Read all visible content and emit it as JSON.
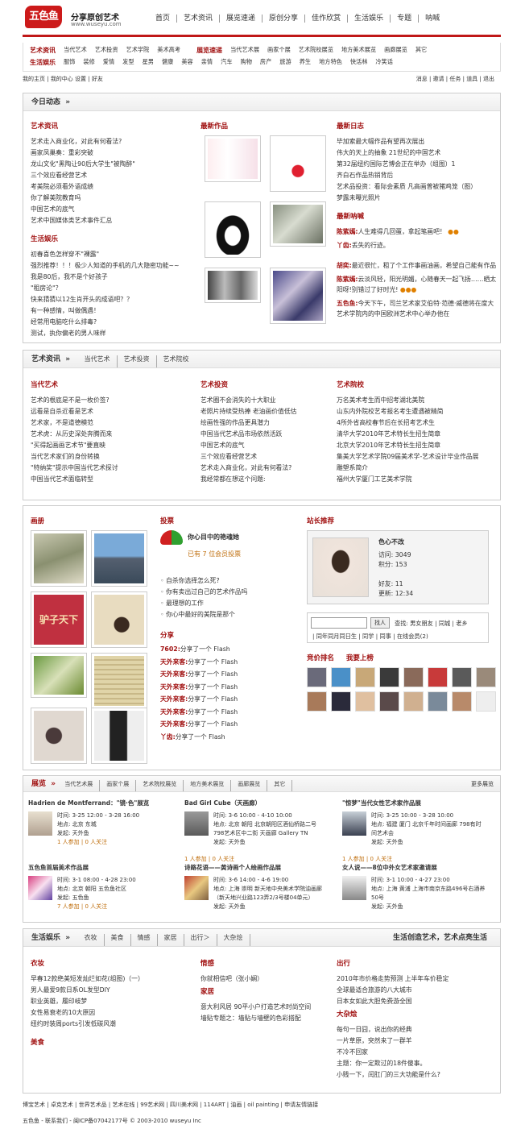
{
  "header": {
    "logo": "五色鱼",
    "slogan": "分享原创艺术",
    "site": "www.wuseyu.com",
    "nav": [
      "首页",
      "艺术资讯",
      "展览速递",
      "原创分享",
      "佳作欣赏",
      "生活娱乐",
      "专题",
      "呐喊"
    ]
  },
  "subnav": {
    "row1": [
      {
        "label": "艺术资讯",
        "items": [
          "当代艺术",
          "艺术投资",
          "艺术学院",
          "美术高考"
        ]
      },
      {
        "label": "展览速递",
        "items": [
          "当代艺术展",
          "画家个展",
          "艺术院校展览",
          "地方美术展览",
          "画廊展览",
          "其它"
        ]
      }
    ],
    "row2": {
      "label": "生活娱乐",
      "items": [
        "服饰",
        "装修",
        "爱情",
        "发型",
        "星男",
        "健康",
        "美容",
        "亲情",
        "汽车",
        "购物",
        "房产",
        "旅游",
        "养生",
        "地方特色",
        "快活林",
        "冷笑话"
      ]
    }
  },
  "userbar": {
    "left": [
      "我的主页",
      "我的中心",
      "设置",
      "好友"
    ],
    "right": [
      "消息",
      "邀请",
      "任务",
      "道具",
      "退出"
    ]
  },
  "today": {
    "title": "今日动态",
    "arrow": "»",
    "art_news": {
      "title": "艺术资讯",
      "items": [
        "艺术走入商业化，对此有何看法?",
        "画家凤巢奏：重彩突破",
        "龙山文化\"黑陶让90后大学生\"被陶醉\"",
        "三个效应看经营艺术",
        "考美院必须看外语成绩",
        "你了解美院教育吗",
        "中国艺术的底气",
        "艺术中国媒体类艺术事件汇总"
      ]
    },
    "life": {
      "title": "生活娱乐",
      "items": [
        "初春喜色怎样穿不\"裸露\"",
        "强烈推荐！！！极少人知道的手机的几大隐密功能~~",
        "我是80后，我不是个好孩子",
        "\"租房论\"？",
        "快来猜猜以12生肖开头的成语吧？？",
        "有一种感情，叫做偶遇！",
        "经常用电脑吃什么排毒?",
        "测试，执你偏老的男人味样"
      ]
    },
    "works": {
      "title": "最新作品"
    },
    "logs": {
      "title": "最新日志",
      "items": [
        "毕加索最大幅作品有望再次展出",
        "伟大的天上的抽象 21世纪的中国艺术",
        "第32届纽约国际艺博会正在举办（组图）1",
        "齐白石作品热销背后",
        "艺术品投资：看际会素质 凡高画曾被猪鸡笼（图）",
        "梦露未曝光照片"
      ]
    },
    "shouts": {
      "title": "最新呐喊",
      "items": [
        {
          "user": "陈紫嫣:",
          "text": "人生难得几回蛋，拿起笔画吧！"
        },
        {
          "user": "丫齿:",
          "text": "丢失的行迹。"
        },
        {
          "user": "胡奕:",
          "text": "最近很忙，租了个工作事画油画，希望自己能有作品"
        },
        {
          "user": "陈紫嫣:",
          "text": "云淡风轻，阳光明媚，心随春天一起飞扬……晒太阳呀!别错过了好时光!"
        },
        {
          "user": "五色鱼:",
          "text": "今天下午，司兰艺术家艾伯特·范德·威德将在度大艺术学院内的中国欧洲艺术中心举办他在"
        }
      ]
    }
  },
  "artnews": {
    "title": "艺术资讯",
    "arrow": "»",
    "tabs": [
      "当代艺术",
      "艺术投资",
      "艺术院校"
    ],
    "contemporary": {
      "title": "当代艺术",
      "items": [
        "艺术的根底是不是一枚价签?",
        "远看是自杀近看是艺术",
        "艺术家，不是道德模范",
        "艺术虎：从历史深处奔腾而来",
        "\"买得起画画艺术节\"要直映",
        "当代艺术家们的身份转换",
        "\"特纳奖\"提示中国当代艺术探讨",
        "中国当代艺术面临转型"
      ]
    },
    "investment": {
      "title": "艺术投资",
      "items": [
        "艺术圈不会消失的十大职业",
        "老照片持续受热捧 老油画价值低估",
        "绘画性强的作品更具潜力",
        "中国当代艺术品市场依然活跃",
        "中国艺术的底气",
        "三个效应看经营艺术",
        "艺术走入商业化，对此有何看法?",
        "我经常都在想这个问题:"
      ]
    },
    "schools": {
      "title": "艺术院校",
      "items": [
        "万名美术考生而中招考湖北美院",
        "山东内外院校艺考报名考生遭遇被精简",
        "4所外省高校春节后在长招考艺术生",
        "清华大学2010年艺术特长生招生简章",
        "北京大学2010年艺术特长生招生简章",
        "集美大学艺术学院09届美术学-艺术设计毕业作品展",
        "雕塑系简介",
        "福州大学厦门工艺美术学院"
      ]
    }
  },
  "gallery": {
    "title": "画册",
    "image_texts": [
      "驴子天下"
    ]
  },
  "vote": {
    "title": "投票",
    "question": "你心目中的艳魂她",
    "count_prefix": "已有",
    "count": "7",
    "count_suffix": "位会员投票",
    "items": [
      "自杀你选择怎么死?",
      "你有卖出过自己的艺术作品吗",
      "最理想的工作",
      "你心中最好的美院是那个"
    ]
  },
  "share": {
    "title": "分享",
    "items": [
      {
        "user": "7602:",
        "text": "分享了一个 Flash"
      },
      {
        "user": "天外来客:",
        "text": "分享了一个 Flash"
      },
      {
        "user": "天外来客:",
        "text": "分享了一个 Flash"
      },
      {
        "user": "天外来客:",
        "text": "分享了一个 Flash"
      },
      {
        "user": "天外来客:",
        "text": "分享了一个 Flash"
      },
      {
        "user": "天外来客:",
        "text": "分享了一个 Flash"
      },
      {
        "user": "天外来客:",
        "text": "分享了一个 Flash"
      },
      {
        "user": "丫齿:",
        "text": "分享了一个 Flash"
      }
    ]
  },
  "recommend": {
    "title": "站长推荐",
    "name": "色心不改",
    "stats": [
      {
        "k": "访问:",
        "v": "3049"
      },
      {
        "k": "积分:",
        "v": "153"
      },
      {
        "k": "好友:",
        "v": "11"
      },
      {
        "k": "更新:",
        "v": "12:34"
      }
    ],
    "find_button": "找人",
    "links1": [
      "查找:",
      "男女朋友",
      "同城",
      "老乡"
    ],
    "links2": [
      "同年同月同日生",
      "同学",
      "同事",
      "在线会员(2)"
    ]
  },
  "ranking": {
    "title": "竞价排名",
    "cta": "我要上榜"
  },
  "exhibit": {
    "title": "展览",
    "arrow": "»",
    "tabs": [
      "当代艺术展",
      "画家个展",
      "艺术院校展览",
      "地方美术展览",
      "画廊展览",
      "其它"
    ],
    "more": "更多展览",
    "items": [
      {
        "title": "Hadrien de Montferrand：\"镜·色\"展览",
        "time": "时间: 3-25 12:00 - 3-28 16:00",
        "place": "地点: 北京 东城",
        "by": "发起: 天外鱼",
        "count": "1 人参加 | 0 人关注"
      },
      {
        "title": "Bad Girl Cube（天画廊）",
        "time": "时间: 3-6 10:00 - 4-10 10:00",
        "place": "地点: 北京 朝阳 北京朝阳区酒仙桥路二号",
        "place2": "798艺术区中二街 天画廊 Gallery TN",
        "by": "发起: 天外鱼",
        "count": "1 人参加 | 0 人关注"
      },
      {
        "title": "\"惊梦\"当代女性艺术家作品展",
        "time": "时间: 3-25 10:00 - 3-28 10:00",
        "place": "地点: 福建 厦门 北京千年时间画廊 798有时",
        "place2": "间艺术会",
        "by": "发起: 天外鱼",
        "count": "1 人参加 | 0 人关注"
      },
      {
        "title": "五色鱼首届美术作品展",
        "time": "时间: 3-1 08:00 - 4-28 23:00",
        "place": "地点: 北京 朝阳 五色鱼社区",
        "by": "发起: 五色鱼",
        "count": "7 人参加 | 0 人关注"
      },
      {
        "title": "诗路花语——黄诗画个人绘画作品展",
        "time": "时间: 3-6 14:00 - 4-6 19:00",
        "place": "地点: 上海 崇明 新天地中央美术学院油画廊",
        "place2": "（新天地兴业路123弄2/3号楼04单元）",
        "by": "发起: 天外鱼",
        "count": ""
      },
      {
        "title": "女人说——8位中外女艺术家邀请展",
        "time": "时间: 3-1 10:00 - 4-27 23:00",
        "place": "地点: 上海 黄浦 上海市南京东路496号右酒养",
        "place2": "50号",
        "by": "发起: 天外鱼",
        "count": ""
      }
    ]
  },
  "lifestyle": {
    "title": "生活娱乐",
    "arrow": "»",
    "tabs": [
      "衣妆",
      "美食",
      "情感",
      "家居",
      "出行＞",
      "大杂烩"
    ],
    "slogan": "生活创造艺术，艺术点亮生活",
    "fashion": {
      "title": "衣妆",
      "items": [
        "早春12款绝美短发灿烂如花(组图)（一）",
        "男人最爱9款日系OL发型DIY",
        "职业英雄，履印岐梦",
        "女性易衰老的10大原因",
        "纽约时装周ports引发低碳风潮"
      ]
    },
    "food": {
      "title": "美食"
    },
    "emotion": {
      "title": "情感",
      "items": [
        "你就相信吧（张小娴）"
      ]
    },
    "home": {
      "title": "家居",
      "items": [
        "意大利风居 90平小户打造艺术时尚空间",
        "墙贴专题之：墙贴与墙壁的色彩搭配"
      ]
    },
    "travel": {
      "title": "出行",
      "items": [
        "2010年市价格走势预测 上半年车价稳定",
        "全球最适合旅游的八大城市",
        "日本女如此大胆免费游全国"
      ]
    },
    "misc": {
      "title": "大杂烩",
      "items": [
        "每句一日囧，说出你的经典",
        "一片草原，突然来了一群羊",
        "不冷不回家",
        "主题：你一定欺过的18件傻事。",
        "小贱一下，闰肛门的三大功能是什么?"
      ]
    }
  },
  "footer": {
    "links": [
      "博宝艺术",
      "卓克艺术",
      "世界艺术品",
      "艺术在线",
      "99艺术网",
      "四川美术网",
      "114ART",
      "油画",
      "oil painting",
      "申请友情链接"
    ],
    "copy": "五色鱼 - 联系我们 - 闽ICP备07042177号 © 2003-2010 wuseyu Inc"
  }
}
